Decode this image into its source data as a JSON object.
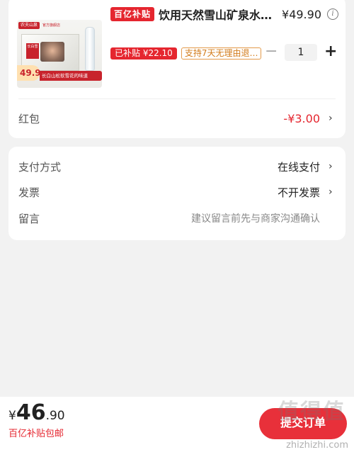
{
  "product": {
    "subsidy_badge": "百亿补贴",
    "name": "饮用天然雪山矿泉水…",
    "unit_price": "¥49.90",
    "subsidy_tag": "已补贴 ¥22.10",
    "return_tag": "支持7天无理由退…",
    "quantity": "1",
    "thumbnail": {
      "brand": "农夫山泉",
      "brand_sub": "官方旗舰店",
      "box_label": "长白雪",
      "price_badge": "49.9",
      "slogan": "长白山松软雪花的味道"
    }
  },
  "red_packet": {
    "label": "红包",
    "value": "-¥3.00"
  },
  "payment": {
    "method_label": "支付方式",
    "method_value": "在线支付",
    "invoice_label": "发票",
    "invoice_value": "不开发票",
    "message_label": "留言",
    "message_placeholder": "建议留言前先与商家沟通确认"
  },
  "bottom": {
    "currency": "¥",
    "total_int": "46",
    "total_dec": ".90",
    "shipping_note": "百亿补贴包邮",
    "submit_label": "提交订单"
  },
  "watermark": {
    "logo": "值得值",
    "url": "zhizhizhi.com"
  },
  "colors": {
    "accent_red": "#e5262f",
    "tag_orange": "#d27b1a",
    "background": "#f2f2f2"
  }
}
